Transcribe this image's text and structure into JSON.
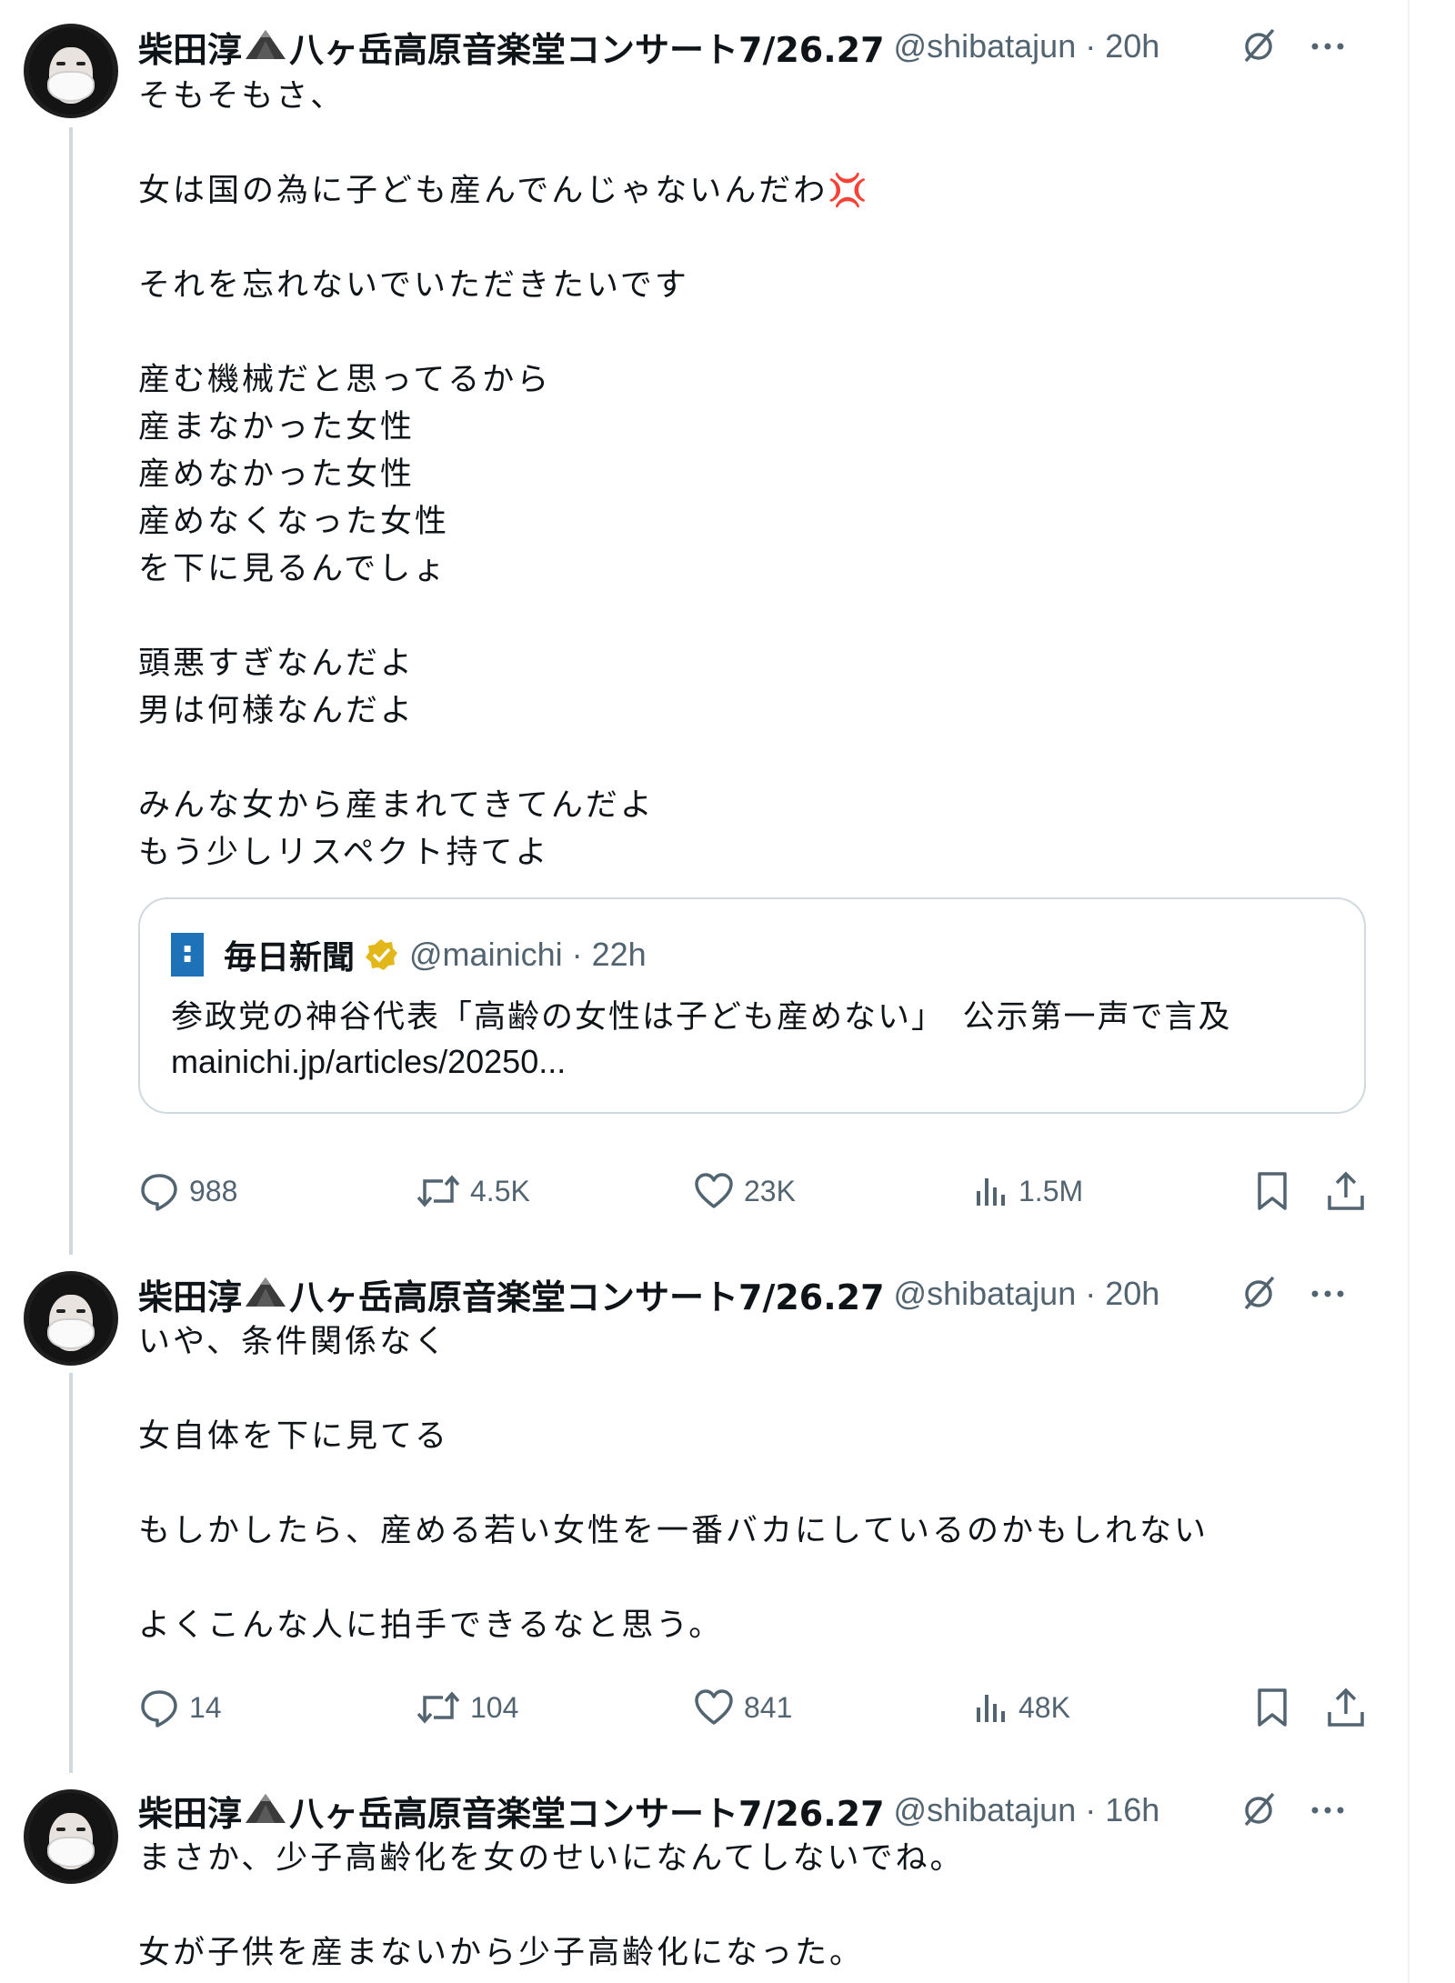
{
  "colors": {
    "text": "#0f1419",
    "secondary": "#536471",
    "border": "#cfd9de",
    "verified": "#e2b719"
  },
  "tweets": [
    {
      "author_name": "柴田淳",
      "author_name_suffix": "八ヶ岳高原音楽堂コンサート7/26.27",
      "handle_time": "@shibatajun · 20h",
      "body": "そもそもさ、\n\n女は国の為に子ども産んでんじゃないんだわ💢\n\nそれを忘れないでいただきたいです\n\n産む機械だと思ってるから\n産まなかった女性\n産めなかった女性\n産めなくなった女性\nを下に見るんでしょ\n\n頭悪すぎなんだよ\n男は何様なんだよ\n\nみんな女から産まれてきてんだよ\nもう少しリスペクト持てよ",
      "quote": {
        "logo_text": "毎日新聞",
        "name": "毎日新聞",
        "handle_time": "@mainichi · 22h",
        "text": "参政党の神谷代表「高齢の女性は子ども産めない」　公示第一声で言及",
        "link": "mainichi.jp/articles/20250..."
      },
      "stats": {
        "replies": "988",
        "retweets": "4.5K",
        "likes": "23K",
        "views": "1.5M"
      }
    },
    {
      "author_name": "柴田淳",
      "author_name_suffix": "八ヶ岳高原音楽堂コンサート7/26.27",
      "handle_time": "@shibatajun · 20h",
      "body": "いや、条件関係なく\n\n女自体を下に見てる\n\nもしかしたら、産める若い女性を一番バカにしているのかもしれない\n\nよくこんな人に拍手できるなと思う。",
      "stats": {
        "replies": "14",
        "retweets": "104",
        "likes": "841",
        "views": "48K"
      }
    },
    {
      "author_name": "柴田淳",
      "author_name_suffix": "八ヶ岳高原音楽堂コンサート7/26.27",
      "handle_time": "@shibatajun · 16h",
      "body": "まさか、少子高齢化を女のせいになんてしないでね。\n\n女が子供を産まないから少子高齢化になった。"
    }
  ]
}
